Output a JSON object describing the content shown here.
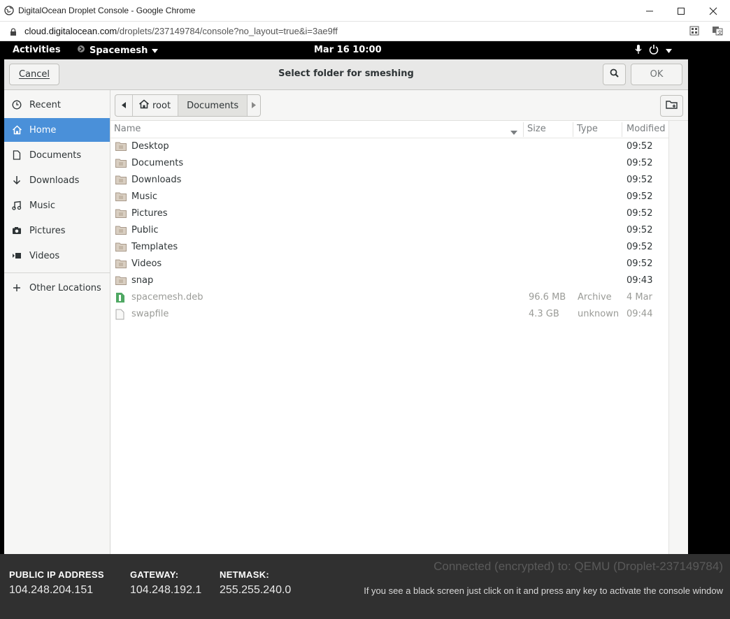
{
  "browser": {
    "window_title": "DigitalOcean Droplet Console - Google Chrome",
    "url_host": "cloud.digitalocean.com",
    "url_path": "/droplets/237149784/console?no_layout=true&i=3ae9ff"
  },
  "gnome": {
    "activities": "Activities",
    "app_name": "Spacemesh",
    "clock": "Mar 16  10:00"
  },
  "dialog": {
    "title": "Select folder for smeshing",
    "cancel_label": "Cancel",
    "ok_label": "OK"
  },
  "sidebar": {
    "items": [
      {
        "label": "Recent",
        "icon": "clock-icon"
      },
      {
        "label": "Home",
        "icon": "home-icon"
      },
      {
        "label": "Documents",
        "icon": "document-icon"
      },
      {
        "label": "Downloads",
        "icon": "download-icon"
      },
      {
        "label": "Music",
        "icon": "music-icon"
      },
      {
        "label": "Pictures",
        "icon": "camera-icon"
      },
      {
        "label": "Videos",
        "icon": "video-icon"
      }
    ],
    "other_locations": "Other Locations"
  },
  "pathbar": {
    "root": "root",
    "current": "Documents"
  },
  "columns": {
    "name": "Name",
    "size": "Size",
    "type": "Type",
    "modified": "Modified"
  },
  "files": [
    {
      "name": "Desktop",
      "size": "",
      "type": "",
      "modified": "09:52",
      "kind": "folder"
    },
    {
      "name": "Documents",
      "size": "",
      "type": "",
      "modified": "09:52",
      "kind": "folder"
    },
    {
      "name": "Downloads",
      "size": "",
      "type": "",
      "modified": "09:52",
      "kind": "folder"
    },
    {
      "name": "Music",
      "size": "",
      "type": "",
      "modified": "09:52",
      "kind": "folder"
    },
    {
      "name": "Pictures",
      "size": "",
      "type": "",
      "modified": "09:52",
      "kind": "folder"
    },
    {
      "name": "Public",
      "size": "",
      "type": "",
      "modified": "09:52",
      "kind": "folder"
    },
    {
      "name": "Templates",
      "size": "",
      "type": "",
      "modified": "09:52",
      "kind": "folder"
    },
    {
      "name": "Videos",
      "size": "",
      "type": "",
      "modified": "09:52",
      "kind": "folder"
    },
    {
      "name": "snap",
      "size": "",
      "type": "",
      "modified": "09:43",
      "kind": "folder"
    },
    {
      "name": "spacemesh.deb",
      "size": "96.6 MB",
      "type": "Archive",
      "modified": "4 Mar",
      "kind": "archive"
    },
    {
      "name": "swapfile",
      "size": "4.3 GB",
      "type": "unknown",
      "modified": "09:44",
      "kind": "file"
    }
  ],
  "console_info": {
    "ip_label": "PUBLIC IP ADDRESS",
    "ip_value": "104.248.204.151",
    "gateway_label": "GATEWAY:",
    "gateway_value": "104.248.192.1",
    "netmask_label": "NETMASK:",
    "netmask_value": "255.255.240.0",
    "connection": "Connected (encrypted) to: QEMU (Droplet-237149784)",
    "hint": "If you see a black screen just click on it and press any key to activate the console window"
  },
  "colors": {
    "selection": "#4a90d9",
    "info_bg": "#303030"
  }
}
